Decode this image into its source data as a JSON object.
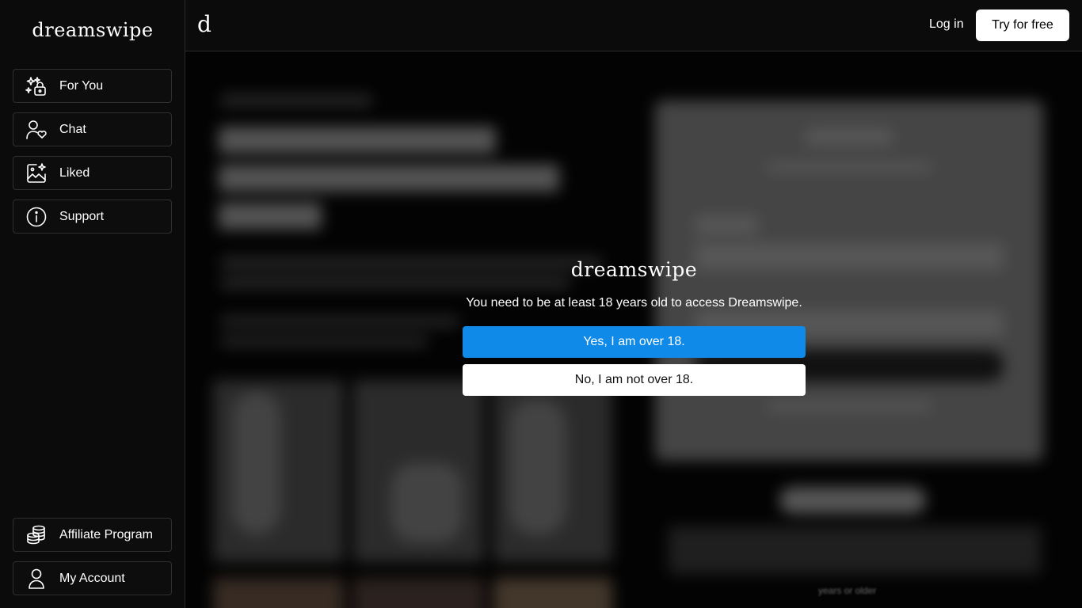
{
  "sidebar": {
    "logo": "dreamswipe",
    "nav_top": [
      {
        "label": "For You",
        "icon": "sparkle-lock-icon"
      },
      {
        "label": "Chat",
        "icon": "user-heart-icon"
      },
      {
        "label": "Liked",
        "icon": "image-sparkle-icon"
      },
      {
        "label": "Support",
        "icon": "info-icon"
      }
    ],
    "nav_bottom": [
      {
        "label": "Affiliate Program",
        "icon": "coins-stack-icon"
      },
      {
        "label": "My Account",
        "icon": "user-icon"
      }
    ]
  },
  "topbar": {
    "mini_logo": "d",
    "login": "Log in",
    "try_free": "Try for free"
  },
  "modal": {
    "logo": "dreamswipe",
    "message": "You need to be at least 18 years old to access Dreamswipe.",
    "yes_label": "Yes, I am over 18.",
    "no_label": "No, I am not over 18."
  },
  "background": {
    "footnote": "years or older"
  },
  "colors": {
    "accent": "#0f8ae8",
    "sidebar_bg": "#0b0b0b",
    "border": "#2f2f2f"
  }
}
